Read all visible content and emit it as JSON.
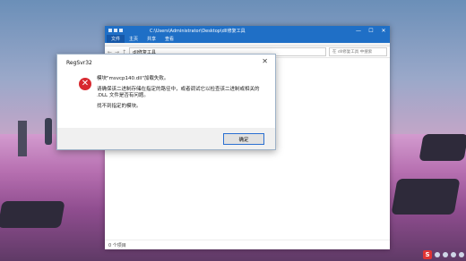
{
  "explorer": {
    "title_path": "C:\\Users\\Administrator\\Desktop\\dll修复工具",
    "ribbon_tabs": [
      "文件",
      "主页",
      "共享",
      "查看"
    ],
    "address": "dll修复工具",
    "search_placeholder": "在 dll修复工具 中搜索",
    "status": "0 个项目",
    "window_controls": [
      "—",
      "☐",
      "✕"
    ],
    "nav_icons": [
      "←",
      "→",
      "↑"
    ]
  },
  "dialog": {
    "title": "RegSvr32",
    "close_glyph": "✕",
    "error_glyph": "✕",
    "line1": "模块\"msvcp140.dll\"加载失败。",
    "line2": "请确保该二进制存储在指定的路径中，或者调试它以检查该二进制或相关的",
    "line3": ".DLL 文件是否有问题。",
    "line4": "找不到指定的模块。",
    "ok_label": "确定"
  },
  "tray": {
    "ime_label": "S"
  },
  "colors": {
    "accent": "#1f6fc6",
    "error": "#d8282f"
  }
}
